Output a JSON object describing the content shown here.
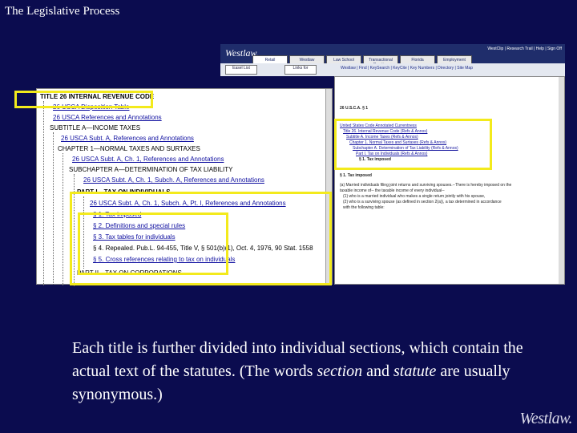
{
  "slide": {
    "title": "The Legislative Process"
  },
  "westlaw_ui": {
    "logo": "Westlaw.",
    "tabs": [
      "Retail",
      "Westlaw",
      "Law School",
      "Transactional Practice",
      "Florida",
      "Employment"
    ],
    "util_links": "WestClip | Research Trail | Help | Sign Off",
    "buttons": [
      "Easel List",
      "Links for"
    ],
    "rowlinks": "Westlaw | Find | KeySearch | KeyCite | Key Numbers | Directory | Site Map"
  },
  "toc": {
    "title_line": "TITLE 26 INTERNAL REVENUE CODE",
    "lines": [
      {
        "text": "26 USCA Disposition Table",
        "link": true
      },
      {
        "text": "26 USCA References and Annotations",
        "link": true
      },
      {
        "text": "SUBTITLE A—INCOME TAXES",
        "link": false
      },
      {
        "text": "26 USCA Subt. A, References and Annotations",
        "link": true
      },
      {
        "text": "CHAPTER 1—NORMAL TAXES AND SURTAXES",
        "link": false
      },
      {
        "text": "26 USCA Subt. A, Ch. 1, References and Annotations",
        "link": true
      },
      {
        "text": "SUBCHAPTER A—DETERMINATION OF TAX LIABILITY",
        "link": false
      },
      {
        "text": "26 USCA Subt. A, Ch. 1, Subch. A, References and Annotations",
        "link": true
      },
      {
        "text": "PART I—TAX ON INDIVIDUALS",
        "link": false
      },
      {
        "text": "26 USCA Subt. A, Ch. 1, Subch. A, Pt. I, References and Annotations",
        "link": true
      }
    ],
    "sections": [
      "§ 1. Tax imposed",
      "§ 2. Definitions and special rules",
      "§ 3. Tax tables for individuals",
      "§ 4. Repealed. Pub.L. 94-455, Title V, § 501(b)(1), Oct. 4, 1976, 90 Stat. 1558",
      "§ 5. Cross references relating to tax on individuals"
    ],
    "last_line": "PART II—TAX ON CORPORATIONS"
  },
  "doc": {
    "cite": "26 U.S.C.A. § 1",
    "heading": "United States Code Annotated Currentness",
    "path": [
      "Title 26. Internal Revenue Code (Refs & Annos)",
      "Subtitle A. Income Taxes (Refs & Annos)",
      "Chapter 1. Normal Taxes and Surtaxes (Refs & Annos)",
      "Subchapter A. Determination of Tax Liability (Refs & Annos)",
      "Part I. Tax on Individuals (Refs & Annos)",
      "§ 1. Tax imposed"
    ],
    "para_head": "§ 1. Tax imposed",
    "body": [
      "(a) Married individuals filing joint returns and surviving spouses.--There is hereby imposed on the",
      "taxable income of-- the taxable income of every individual--",
      "(1) who is a married individual who makes a single return jointly with his spouse,",
      "(2) who is a surviving spouse (as defined in section 2(a)), a tax determined in accordance",
      "with the following table:"
    ]
  },
  "caption": {
    "part1": "Each title is further divided into individual sections, which contain the actual text of the statutes.  (The words ",
    "em1": "section",
    "mid": " and ",
    "em2": "statute",
    "part2": " are usually synonymous.)"
  },
  "brand": "Westlaw."
}
